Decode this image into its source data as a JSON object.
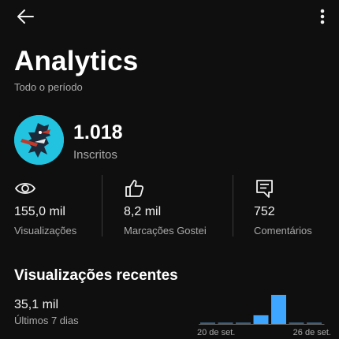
{
  "header": {
    "back_icon": "arrow-left-icon",
    "menu_icon": "more-vertical-icon"
  },
  "page": {
    "title": "Analytics",
    "subtitle": "Todo o período"
  },
  "channel": {
    "subscribers_value": "1.018",
    "subscribers_label": "Inscritos"
  },
  "stats": [
    {
      "icon": "eye-icon",
      "value": "155,0 mil",
      "label": "Visualizações"
    },
    {
      "icon": "thumbs-up-icon",
      "value": "8,2 mil",
      "label": "Marcações Gostei"
    },
    {
      "icon": "comment-icon",
      "value": "752",
      "label": "Comentários"
    }
  ],
  "recent": {
    "title": "Visualizações recentes",
    "value": "35,1 mil",
    "period": "Últimos 7 dias"
  },
  "chart_data": {
    "type": "bar",
    "x_tick_labels": [
      "20 de set.",
      "26 de set."
    ],
    "values": [
      0.05,
      0.05,
      0.05,
      0.3,
      1.0,
      0.05,
      0.05
    ],
    "colors": {
      "bar": "#3ea6ff",
      "bar_dim": "#3a5f80",
      "baseline": "#5a5a5a"
    }
  }
}
